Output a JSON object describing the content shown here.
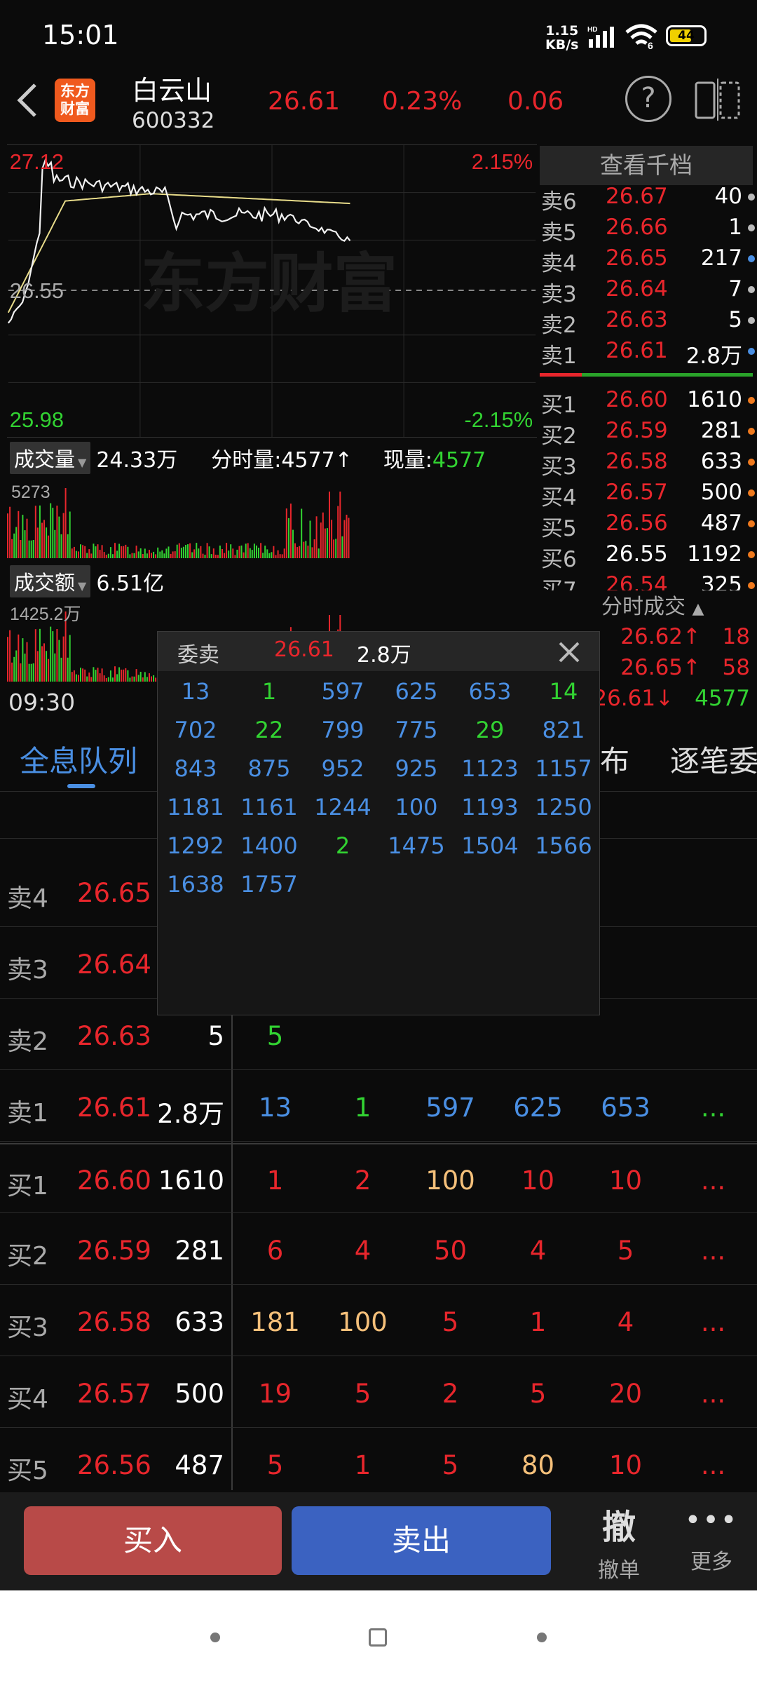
{
  "status_bar": {
    "time": "15:01",
    "net_speed": "1.15",
    "net_unit": "KB/s",
    "signal_label": "HD",
    "battery": "44"
  },
  "header": {
    "logo_text": "东方财富",
    "stock_name": "白云山",
    "stock_code": "600332",
    "price": "26.61",
    "change_pct": "0.23%",
    "change": "0.06"
  },
  "chart": {
    "price_high": "27.12",
    "price_pct_high": "2.15%",
    "price_ref": "26.55",
    "price_low": "25.98",
    "price_pct_low": "-2.15%",
    "watermark": "东方财富",
    "vol_tag": "成交量",
    "vol_value": "24.33万",
    "fs_label": "分时量:4577↑",
    "now_label": "现量:",
    "now_value": "4577",
    "vol_max": "5273",
    "amt_tag": "成交额",
    "amt_value": "6.51亿",
    "amt_max": "1425.2万",
    "time_start": "09:30"
  },
  "order_book": {
    "title": "查看千档",
    "asks": [
      {
        "label": "卖6",
        "price": "26.67",
        "vol": "40"
      },
      {
        "label": "卖5",
        "price": "26.66",
        "vol": "1"
      },
      {
        "label": "卖4",
        "price": "26.65",
        "vol": "217"
      },
      {
        "label": "卖3",
        "price": "26.64",
        "vol": "7"
      },
      {
        "label": "卖2",
        "price": "26.63",
        "vol": "5"
      },
      {
        "label": "卖1",
        "price": "26.61",
        "vol": "2.8万"
      }
    ],
    "bids": [
      {
        "label": "买1",
        "price": "26.60",
        "vol": "1610"
      },
      {
        "label": "买2",
        "price": "26.59",
        "vol": "281"
      },
      {
        "label": "买3",
        "price": "26.58",
        "vol": "633"
      },
      {
        "label": "买4",
        "price": "26.57",
        "vol": "500"
      },
      {
        "label": "买5",
        "price": "26.56",
        "vol": "487"
      },
      {
        "label": "买6",
        "price": "26.55",
        "vol": "1192"
      },
      {
        "label": "买7",
        "price": "26.54",
        "vol": "325"
      }
    ]
  },
  "trades": {
    "title": "分时成交",
    "rows": [
      {
        "price": "26.62↑",
        "vol": "18"
      },
      {
        "price": "26.65↑",
        "vol": "58"
      },
      {
        "price": "26.61↓",
        "vol": "4577"
      }
    ]
  },
  "popup": {
    "title": "委卖",
    "price": "26.61",
    "vol": "2.8万",
    "cells": [
      [
        "13",
        "1",
        "597",
        "625",
        "653",
        "14"
      ],
      [
        "702",
        "22",
        "799",
        "775",
        "29",
        "821"
      ],
      [
        "843",
        "875",
        "952",
        "925",
        "1123",
        "1157"
      ],
      [
        "1181",
        "1161",
        "1244",
        "100",
        "1193",
        "1250"
      ],
      [
        "1292",
        "1400",
        "2",
        "1475",
        "1504",
        "1566"
      ],
      [
        "1638",
        "1757"
      ]
    ]
  },
  "tabs": {
    "active": "全息队列",
    "partial1": "布",
    "partial2": "逐笔委"
  },
  "queue": {
    "rows": [
      {
        "label": "卖4",
        "price": "26.65",
        "vol": "",
        "cells": []
      },
      {
        "label": "卖3",
        "price": "26.64",
        "vol": "",
        "cells": []
      },
      {
        "label": "卖2",
        "price": "26.63",
        "vol": "5",
        "cells": [
          "5"
        ]
      },
      {
        "label": "卖1",
        "price": "26.61",
        "vol": "2.8万",
        "cells": [
          "13",
          "1",
          "597",
          "625",
          "653",
          "..."
        ]
      },
      {
        "label": "买1",
        "price": "26.60",
        "vol": "1610",
        "cells": [
          "1",
          "2",
          "100",
          "10",
          "10",
          "..."
        ]
      },
      {
        "label": "买2",
        "price": "26.59",
        "vol": "281",
        "cells": [
          "6",
          "4",
          "50",
          "4",
          "5",
          "..."
        ]
      },
      {
        "label": "买3",
        "price": "26.58",
        "vol": "633",
        "cells": [
          "181",
          "100",
          "5",
          "1",
          "4",
          "..."
        ]
      },
      {
        "label": "买4",
        "price": "26.57",
        "vol": "500",
        "cells": [
          "19",
          "5",
          "2",
          "5",
          "20",
          "..."
        ]
      },
      {
        "label": "买5",
        "price": "26.56",
        "vol": "487",
        "cells": [
          "5",
          "1",
          "5",
          "80",
          "10",
          "..."
        ]
      }
    ]
  },
  "bottom": {
    "buy": "买入",
    "sell": "卖出",
    "cancel_icon_text": "撤",
    "cancel": "撤单",
    "more": "更多"
  }
}
